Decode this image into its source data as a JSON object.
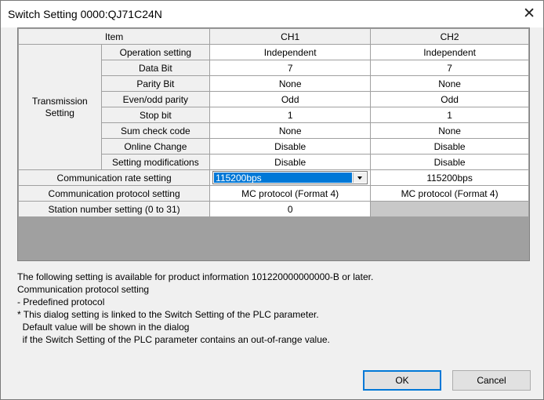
{
  "window": {
    "title": "Switch Setting 0000:QJ71C24N",
    "close_icon": "close-icon"
  },
  "table": {
    "headers": {
      "item": "Item",
      "ch1": "CH1",
      "ch2": "CH2"
    },
    "group_label": "Transmission\nSetting",
    "transmission_rows": [
      {
        "label": "Operation setting",
        "ch1": "Independent",
        "ch2": "Independent"
      },
      {
        "label": "Data Bit",
        "ch1": "7",
        "ch2": "7"
      },
      {
        "label": "Parity Bit",
        "ch1": "None",
        "ch2": "None"
      },
      {
        "label": "Even/odd parity",
        "ch1": "Odd",
        "ch2": "Odd"
      },
      {
        "label": "Stop bit",
        "ch1": "1",
        "ch2": "1"
      },
      {
        "label": "Sum check code",
        "ch1": "None",
        "ch2": "None"
      },
      {
        "label": "Online Change",
        "ch1": "Disable",
        "ch2": "Disable"
      },
      {
        "label": "Setting modifications",
        "ch1": "Disable",
        "ch2": "Disable"
      }
    ],
    "comm_rate": {
      "label": "Communication rate setting",
      "ch1_selected": "115200bps",
      "ch2": "115200bps"
    },
    "comm_protocol": {
      "label": "Communication protocol setting",
      "ch1": "MC protocol (Format 4)",
      "ch2": "MC protocol (Format 4)"
    },
    "station": {
      "label": "Station number setting (0 to 31)",
      "ch1": "0",
      "ch2": ""
    }
  },
  "notes": [
    "The following setting is available for product information 101220000000000-B or later.",
    "Communication protocol setting",
    "- Predefined protocol",
    "",
    "* This dialog setting is linked to the Switch Setting of the PLC parameter.",
    "  Default value will be shown in the dialog",
    "  if the Switch Setting of the PLC parameter contains an out-of-range value."
  ],
  "buttons": {
    "ok": "OK",
    "cancel": "Cancel"
  },
  "colors": {
    "selection": "#0078d7",
    "disabled_cell": "#c8c8c8",
    "grid": "#a0a0a0"
  }
}
